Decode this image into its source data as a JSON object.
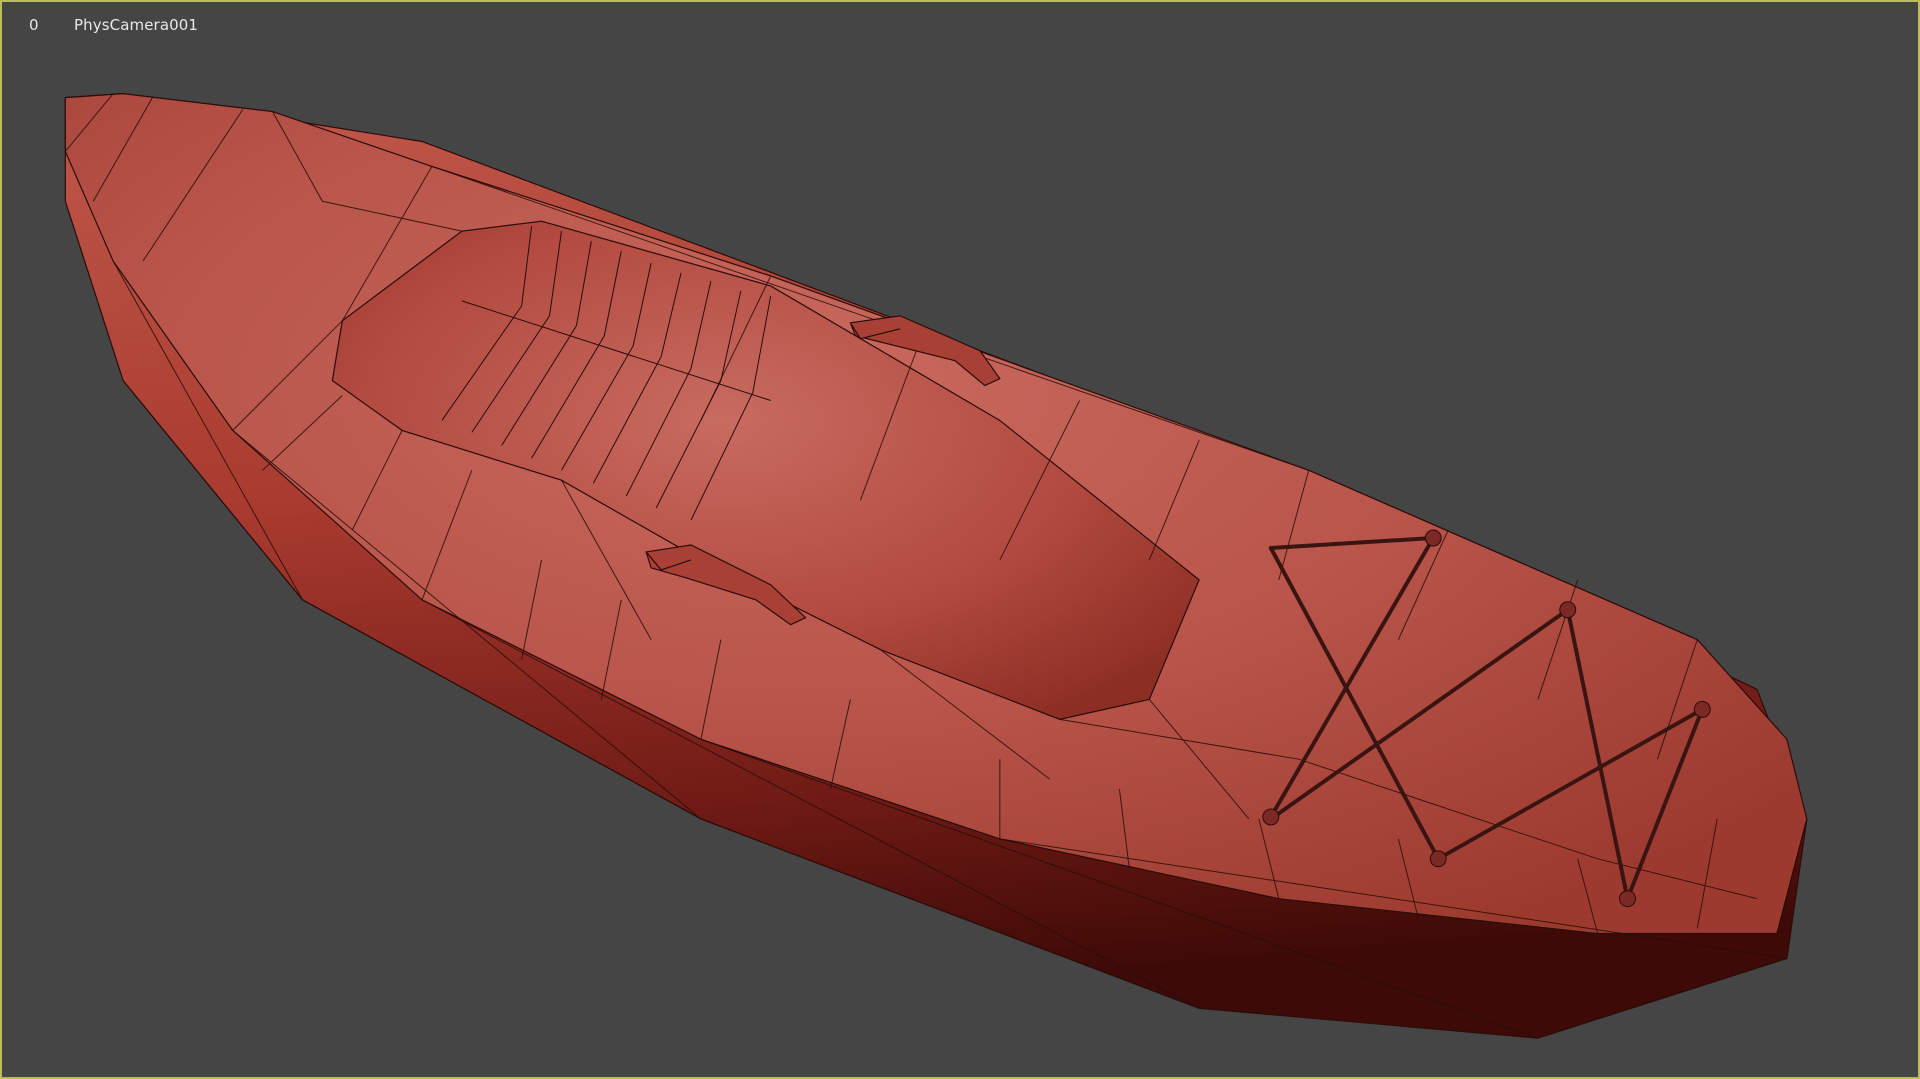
{
  "viewport": {
    "index_label": "0",
    "camera_label": "PhysCamera001",
    "shading": "wireframe-over-shaded",
    "object": "kayak",
    "colors": {
      "background": "#454545",
      "active_border": "#bdbd55",
      "hull": "#b5483c",
      "hull_dark": "#5a120e",
      "wire": "#2a0c08"
    }
  }
}
